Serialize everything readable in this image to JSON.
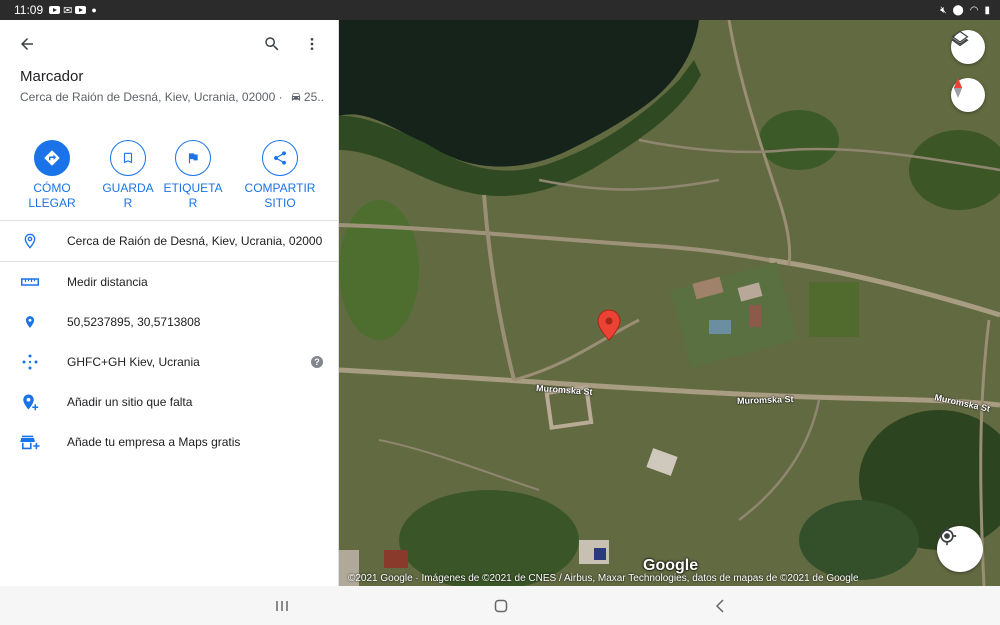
{
  "status_bar": {
    "time": "11:09",
    "icons": [
      "youtube-icon",
      "gmail-icon",
      "youtube-icon",
      "dot-icon"
    ],
    "right_icons": [
      "mute-icon",
      "location-icon",
      "wifi-icon",
      "battery-icon"
    ]
  },
  "panel": {
    "top_icons": [
      "back-arrow-icon",
      "search-icon",
      "more-vert-icon"
    ],
    "title": "Marcador",
    "subtitle": "Cerca de Raión de Desná, Kiev, Ucrania, 02000 · ",
    "subtitle_distance": "25...",
    "actions": [
      {
        "label_line1": "CÓMO",
        "label_line2": "LLEGAR",
        "icon": "directions-icon"
      },
      {
        "label_line1": "GUARDA",
        "label_line2": "R",
        "icon": "bookmark-icon"
      },
      {
        "label_line1": "ETIQUETA",
        "label_line2": "R",
        "icon": "flag-icon"
      },
      {
        "label_line1": "COMPARTIR",
        "label_line2": "SITIO",
        "icon": "share-icon"
      }
    ],
    "rows": [
      {
        "text": "Cerca de Raión de Desná, Kiev, Ucrania, 02000",
        "icon": "location-pin-icon"
      },
      {
        "text": "Medir distancia",
        "icon": "ruler-icon"
      },
      {
        "text": "50,5237895, 30,5713808",
        "icon": "pin-icon"
      },
      {
        "text": "GHFC+GH Kiev, Ucrania",
        "icon": "plus-code-icon",
        "help": "?"
      },
      {
        "text": "Añadir un sitio que falta",
        "icon": "add-place-icon"
      },
      {
        "text": "Añade tu empresa a Maps gratis",
        "icon": "add-business-icon"
      }
    ]
  },
  "map": {
    "streets": [
      "Muromska St",
      "Muromska St",
      "Muromska St"
    ],
    "logo": "Google",
    "attribution": "©2021 Google · Imágenes de ©2021 de CNES / Airbus, Maxar Technologies, datos de mapas de ©2021 de Google",
    "marker_color": "#ea4335"
  },
  "colors": {
    "accent": "#1a73e8",
    "text_primary": "#202124",
    "text_secondary": "#5f6368"
  }
}
